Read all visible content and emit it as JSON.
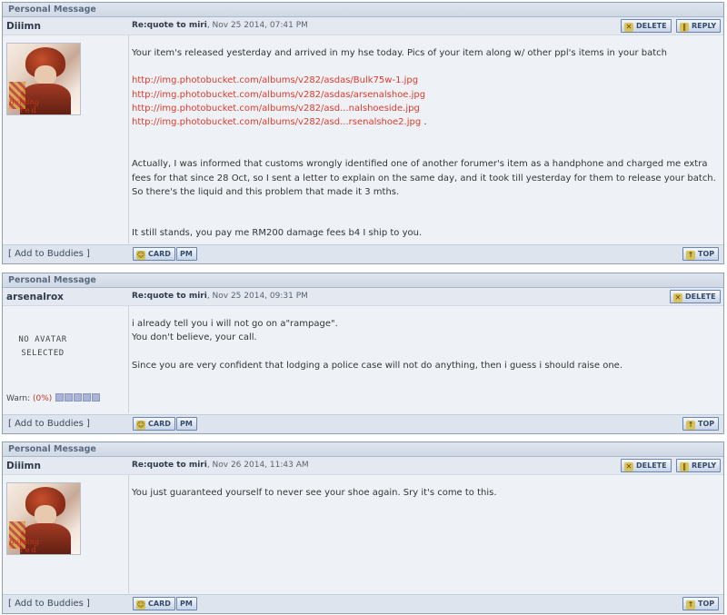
{
  "common": {
    "header": "Personal Message",
    "delete": "DELETE",
    "reply": "REPLY",
    "card": "CARD",
    "pm": "PM",
    "top": "TOP",
    "add_buddies": "[ Add to Buddies ]"
  },
  "posts": [
    {
      "author": "Diiimn",
      "subject": "Re:quote to miri",
      "date": ", Nov 25 2014, 07:41 PM",
      "avatar_logo_1": "Burning",
      "avatar_logo_2": "red",
      "para1": "Your item's released yesterday and arrived in my hse today. Pics of your item along w/ other ppl's items in your batch",
      "links": [
        "http://img.photobucket.com/albums/v282/asdas/Bulk75w-1.jpg",
        "http://img.photobucket.com/albums/v282/asdas/arsenalshoe.jpg",
        "http://img.photobucket.com/albums/v282/asd...nalshoeside.jpg",
        "http://img.photobucket.com/albums/v282/asd...rsenalshoe2.jpg"
      ],
      "link_suffix": " .",
      "para2": "Actually, I was informed that customs wrongly identified one of another forumer's item as a handphone and charged me extra fees for that since 28 Oct, so I sent a letter to explain on the same day, and it took till yesterday for them to release your batch. So there's the liquid and this problem that made it 3 mths.",
      "para3": "It still stands, you pay me RM200 damage fees b4 I ship to you."
    },
    {
      "author": "arsenalrox",
      "subject": "Re:quote to miri",
      "date": ", Nov 25 2014, 09:31 PM",
      "noavatar_1": "NO AVATAR",
      "noavatar_2": "SELECTED",
      "warn_label": "Warn: ",
      "warn_pct": "(0%)",
      "line1": "i already tell you i will not go on a\"rampage\".",
      "line2": "You don't believe, your call.",
      "line3": "Since you are very confident that lodging a police case will not do anything, then i guess i should raise one."
    },
    {
      "author": "Diiimn",
      "subject": "Re:quote to miri",
      "date": ", Nov 26 2014, 11:43 AM",
      "avatar_logo_1": "Burning",
      "avatar_logo_2": "red",
      "line1": "You just guaranteed yourself to never see your shoe again. Sry it's come to this."
    }
  ]
}
